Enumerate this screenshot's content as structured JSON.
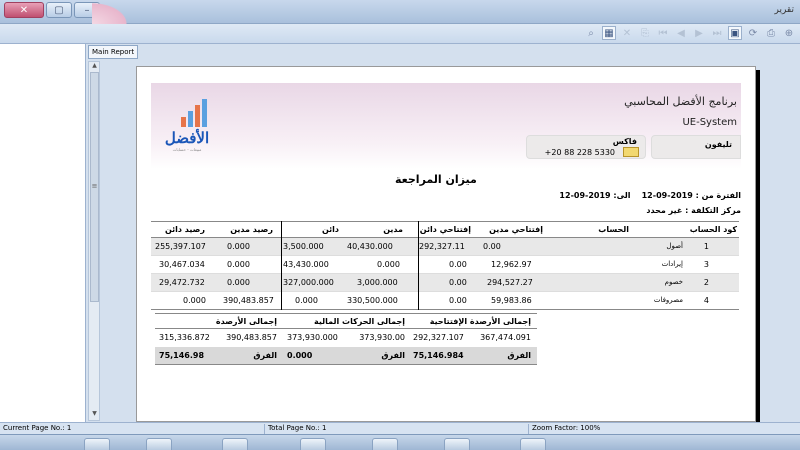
{
  "window": {
    "title": "تقرير"
  },
  "report_tab": "Main Report",
  "header": {
    "company": "برنامج الأفضل المحاسبي",
    "system": "UE-System",
    "logo_text": "الأفضل",
    "logo_sub": "مبيعات - حسابات",
    "fax_label": "فاكس",
    "fax_value": "+20 88 228 5330",
    "phone_label": "تليفون"
  },
  "report": {
    "title": "ميزان المراجعة",
    "period_label": "الفترة من :",
    "period_from": "2019-09-12",
    "period_to_label": "الى:",
    "period_to": "2019-09-12",
    "cost_center": "مركز التكلفة : غير محدد"
  },
  "table": {
    "headers": {
      "code": "كود الحساب",
      "account": "الحساب",
      "open_debit": "إفتتاحي مدين",
      "open_credit": "إفتتاحي دائن",
      "debit": "مدين",
      "credit": "دائن",
      "bal_debit": "رصيد مدين",
      "bal_credit": "رصيد دائن"
    },
    "rows": [
      {
        "code": "1",
        "account": "أصول",
        "open_debit": "0.00",
        "open_credit": "292,327.11",
        "debit": "40,430.000",
        "credit": "3,500.000",
        "bal_debit": "0.000",
        "bal_credit": "255,397.107"
      },
      {
        "code": "3",
        "account": "إيرادات",
        "open_debit": "12,962.97",
        "open_credit": "0.00",
        "debit": "0.000",
        "credit": "43,430.000",
        "bal_debit": "0.000",
        "bal_credit": "30,467.034"
      },
      {
        "code": "2",
        "account": "خصوم",
        "open_debit": "294,527.27",
        "open_credit": "0.00",
        "debit": "3,000.000",
        "credit": "327,000.000",
        "bal_debit": "0.000",
        "bal_credit": "29,472.732"
      },
      {
        "code": "4",
        "account": "مصروفات",
        "open_debit": "59,983.86",
        "open_credit": "0.00",
        "debit": "330,500.000",
        "credit": "0.000",
        "bal_debit": "390,483.857",
        "bal_credit": "0.000"
      }
    ]
  },
  "summaries": {
    "opening": {
      "title": "إجمالى الأرصدة الإفتتاحية",
      "right": "367,474.091",
      "left": "292,327.107",
      "diff_label": "الفرق",
      "diff": "75,146.984"
    },
    "movements": {
      "title": "إجمالى الحركات المالية",
      "right": "373,930.00",
      "left": "373,930.000",
      "diff_label": "الفرق",
      "diff": "0.000"
    },
    "balances": {
      "title": "إجمالى الأرصدة",
      "right": "390,483.857",
      "left": "315,336.872",
      "diff_label": "الفرق",
      "diff": "75,146.98"
    }
  },
  "status": {
    "current_page": "Current Page No.: 1",
    "total_page": "Total Page No.: 1",
    "zoom": "Zoom Factor: 100%"
  },
  "colors": {
    "accent": "#1a56b8",
    "band": "#e9d7e6",
    "row_alt": "#e8e8e8"
  }
}
